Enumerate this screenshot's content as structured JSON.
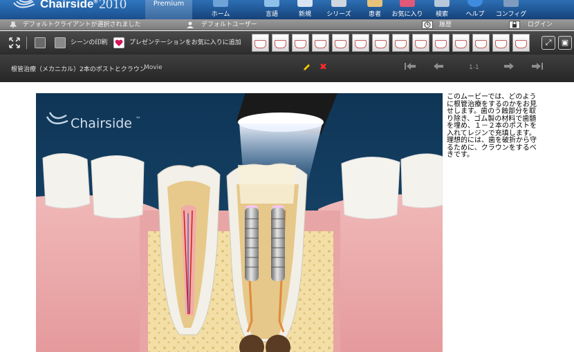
{
  "app": {
    "brand": "Chairside",
    "trademark": "®",
    "year": "2010",
    "edition": "Premium"
  },
  "nav": [
    {
      "label": "ホーム",
      "icon": "home-icon"
    },
    {
      "label": "言語",
      "icon": "language-icon"
    },
    {
      "label": "新規",
      "icon": "new-icon"
    },
    {
      "label": "シリーズ",
      "icon": "series-icon"
    },
    {
      "label": "患者",
      "icon": "patient-icon"
    },
    {
      "label": "お気に入り",
      "icon": "favorites-icon"
    },
    {
      "label": "検索",
      "icon": "search-icon"
    },
    {
      "label": "ヘルプ",
      "icon": "help-icon"
    },
    {
      "label": "コンフィグ",
      "icon": "config-icon"
    }
  ],
  "status": {
    "client": "デフォルトクライアントが選択されました",
    "user": "デフォルトユーザー",
    "history": "履歴",
    "login": "ログイン"
  },
  "toolbar": {
    "print_scene": "シーンの印刷",
    "add_favorite": "プレゼンテーションをお気に入りに追加"
  },
  "title": {
    "text": "根管治療（メカニカル）2本のポストとクラウン",
    "tag": "Movie",
    "page": "1-1"
  },
  "video": {
    "watermark": "Chairside",
    "watermark_tm": "™"
  },
  "description": "このムービーでは、どのように根管治療をするのかをお見せします。歯のう蝕部分を取り除き、ゴム製の材料で歯髄を埋め、１－２本のポストを入れてレジンで充填します。理想的には、歯を破折から守るために、クラウンをするべきです。",
  "colors": {
    "nav_blue": "#1d57a0",
    "gum_pink": "#e9a9a9",
    "tooth_white": "#f5f3ec",
    "delete_red": "#ff2a2a",
    "edit_yellow": "#f4c800"
  }
}
